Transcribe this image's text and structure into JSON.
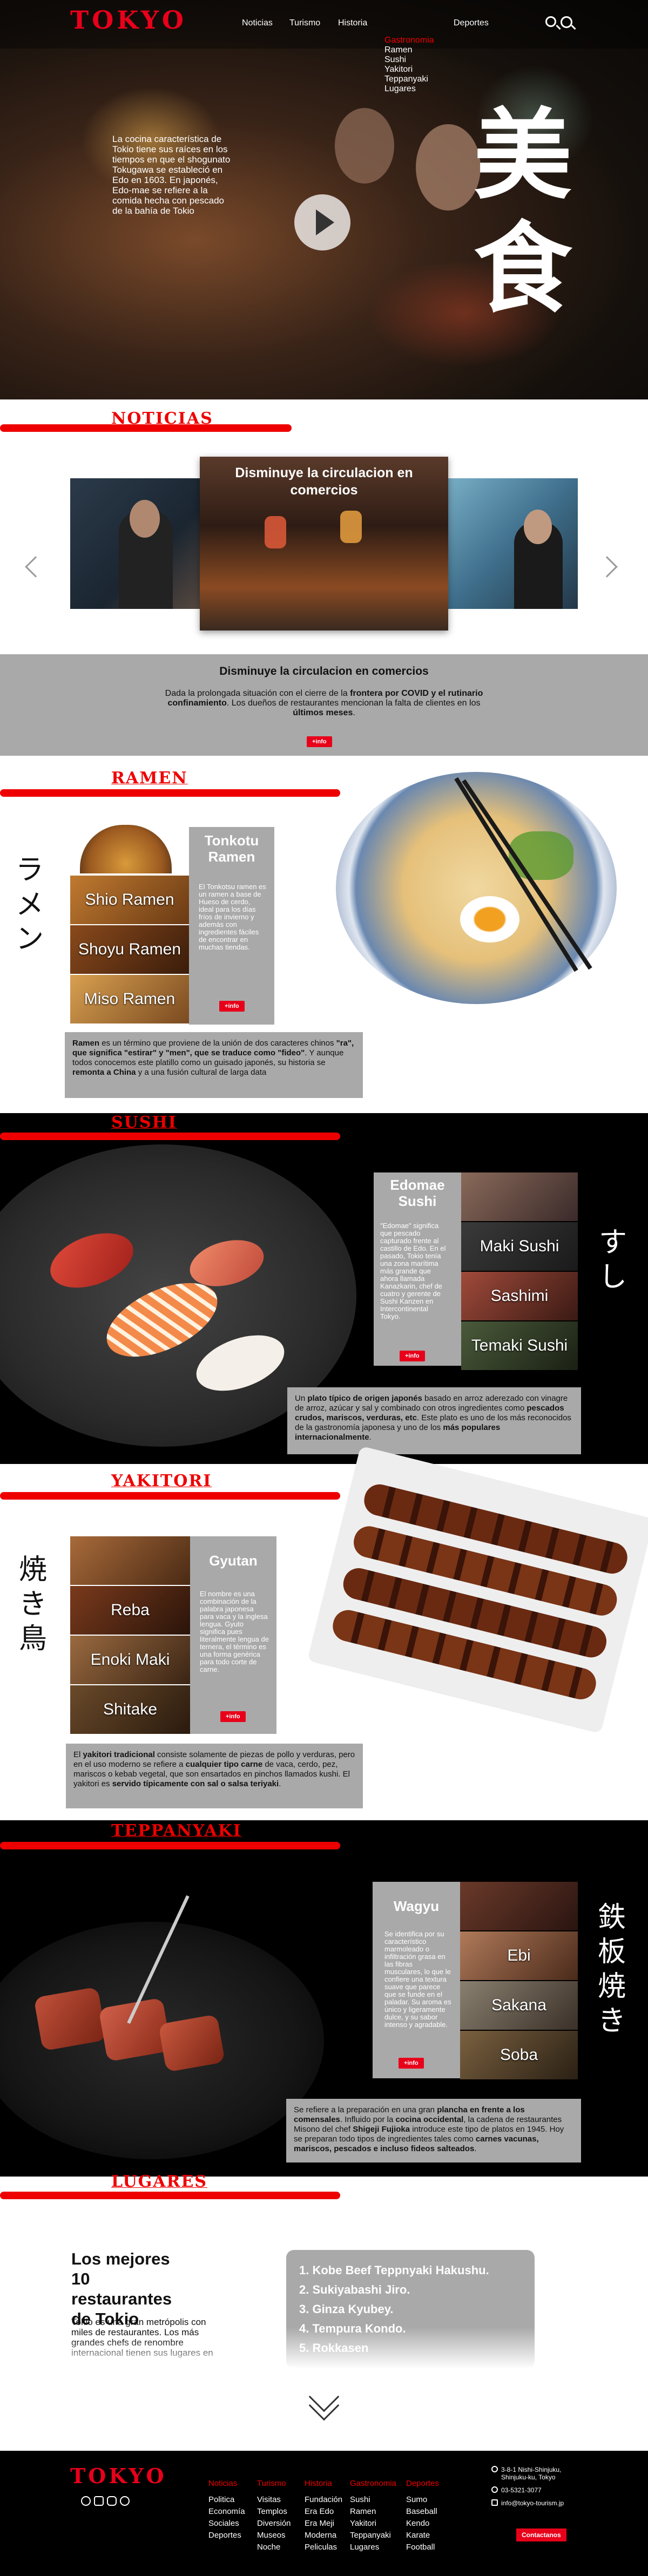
{
  "header": {
    "logo": "TOKYO",
    "nav": [
      "Noticias",
      "Turismo",
      "Historia",
      "Deportes"
    ],
    "gastro_menu": {
      "title": "Gastronomia",
      "items": [
        "Ramen",
        "Sushi",
        "Yakitori",
        "Teppanyaki",
        "Lugares"
      ]
    }
  },
  "hero": {
    "text": "La cocina característica de Tokio tiene sus raíces en los tiempos en que el shogunato Tokugawa se estableció en Edo en 1603. En japonés, Edo-mae se refiere a la comida hecha con pescado de la bahía de Tokio",
    "kanji": [
      "美",
      "食"
    ]
  },
  "news": {
    "title": "NOTICIAS",
    "card_title": "Disminuye la circulacion en comercios",
    "box_title": "Disminuye la circulacion en comercios",
    "box_text_a": "Dada la prolongada situación con el cierre de la ",
    "box_b1": "frontera por COVID y el rutinario confinamiento",
    "box_text_b": ". Los dueños de restaurantes mencionan la falta de clientes en los ",
    "box_b2": "últimos meses",
    "box_text_c": ".",
    "btn": "+info"
  },
  "ramen": {
    "title": "RAMEN",
    "kanji": [
      "ラ",
      "メ",
      "ン"
    ],
    "tiles": [
      "Shio Ramen",
      "Shoyu Ramen",
      "Miso Ramen"
    ],
    "side_title": "Tonkotu Ramen",
    "side_text": "El Tonkotsu ramen es un ramen a base de Hueso de cerdo, ideal para los días fríos de invierno y además con ingredientes fáciles de encontrar en muchas tiendas.",
    "btn": "+info",
    "desc": [
      {
        "b": "Ramen"
      },
      {
        "t": " es un término que proviene de la unión de dos caracteres chinos "
      },
      {
        "b": "\"ra\", que significa \"estirar\" y \"men\", que se traduce como \"fideo\""
      },
      {
        "t": ". Y aunque todos conocemos este platillo como un guisado japonés, su historia se "
      },
      {
        "b": "remonta a China"
      },
      {
        "t": " y a una fusión cultural de larga data"
      }
    ]
  },
  "sushi": {
    "title": "SUSHI",
    "kanji": [
      "す",
      "し"
    ],
    "side_title": "Edomae Sushi",
    "side_text": "\"Edomae\" significa que pescado capturado frente al castillo de Edo. En el pasado, Tokio tenía una zona marítima más grande que ahora llamada Kanazkarin, chef de cuatro y gerente de Sushi Kanzen en Intercontinental Tokyo.",
    "tiles": [
      "Maki Sushi",
      "Sashimi",
      "Temaki Sushi"
    ],
    "btn": "+info",
    "desc": [
      {
        "t": "Un "
      },
      {
        "b": "plato típico de origen japonés"
      },
      {
        "t": " basado en arroz aderezado con vinagre de arroz, azúcar y sal y combinado con otros ingredientes como "
      },
      {
        "b": "pescados crudos, mariscos, verduras, etc"
      },
      {
        "t": ". Este plato es uno de los más reconocidos de la gastronomía japonesa y uno de los "
      },
      {
        "b": "más populares internacionalmente"
      },
      {
        "t": "."
      }
    ]
  },
  "yakitori": {
    "title": "YAKITORI",
    "kanji": [
      "焼",
      "き",
      "鳥"
    ],
    "tiles": [
      "Reba",
      "Enoki Maki",
      "Shitake"
    ],
    "side_title": "Gyutan",
    "side_text": "El nombre es una combinación de la palabra japonesa para vaca y la inglesa lengua. Gyuto significa pues literalmente lengua de ternera, el término es una forma genérica para todo corte de carne.",
    "btn": "+info",
    "desc": [
      {
        "t": "El "
      },
      {
        "b": "yakitori tradicional"
      },
      {
        "t": " consiste solamente de piezas de pollo y verduras, pero en el uso moderno se refiere a "
      },
      {
        "b": "cualquier tipo carne"
      },
      {
        "t": " de vaca, cerdo, pez, mariscos o kebab vegetal, que son ensartados en pinchos llamados kushi. El yakitori es "
      },
      {
        "b": "servido típicamente con sal o salsa teriyaki"
      },
      {
        "t": "."
      }
    ]
  },
  "teppanyaki": {
    "title": "TEPPANYAKI",
    "kanji": [
      "鉄",
      "板",
      "焼",
      "き"
    ],
    "side_title": "Wagyu",
    "side_text": "Se identifica por su característico marmoleado o infiltración grasa en las fibras musculares, lo que le confiere una textura suave que parece que se funde en el paladar. Su aroma es único y ligeramente dulce, y su sabor intenso y agradable.",
    "tiles": [
      "Ebi",
      "Sakana",
      "Soba"
    ],
    "btn": "+info",
    "desc": [
      {
        "t": "Se refiere a la preparación en una gran "
      },
      {
        "b": "plancha en frente a los comensales"
      },
      {
        "t": ". Influido por la "
      },
      {
        "b": "cocina occidental"
      },
      {
        "t": ", la cadena de restaurantes Misono del chef "
      },
      {
        "b": "Shigeji Fujioka"
      },
      {
        "t": " introduce este tipo de platos en 1945. Hoy se preparan todo tipos de ingredientes tales como "
      },
      {
        "b": "carnes vacunas, mariscos, pescados e incluso fideos salteados"
      },
      {
        "t": "."
      }
    ]
  },
  "lugares": {
    "title": "LUGARES",
    "heading": "Los mejores 10 restaurantes de Tokio",
    "text": "Tokio es una gran metrópolis con miles de restaurantes. Los más grandes chefs de renombre internacional tienen sus lugares en",
    "list": [
      "1. Kobe Beef Teppnyaki Hakushu.",
      "2. Sukiyabashi Jiro.",
      "3. Ginza Kyubey.",
      "4. Tempura Kondo.",
      "5. Rokkasen"
    ]
  },
  "footer": {
    "logo": "TOKYO",
    "cols": [
      {
        "h": "Noticias",
        "items": [
          "Politica",
          "Economía",
          "Sociales",
          "Deportes"
        ]
      },
      {
        "h": "Turismo",
        "items": [
          "Visitas",
          "Templos",
          "Diversión",
          "Museos",
          "Noche"
        ]
      },
      {
        "h": "Historia",
        "items": [
          "Fundación",
          "Era Edo",
          "Era Meji",
          "Moderna",
          "Peliculas"
        ]
      },
      {
        "h": "Gastronomia",
        "items": [
          "Sushi",
          "Ramen",
          "Yakitori",
          "Teppanyaki",
          "Lugares"
        ]
      },
      {
        "h": "Deportes",
        "items": [
          "Sumo",
          "Baseball",
          "Kendo",
          "Karate",
          "Football"
        ]
      }
    ],
    "address": "3-8-1 Nishi-Shinjuku, Shinjuku-ku, Tokyo",
    "phone": "03-5321-3077",
    "email": "info@tokyo-tourism.jp",
    "contact_btn": "Contactanos"
  },
  "colors": {
    "accent": "#e8001a",
    "panel": "#a9a9a9",
    "dark": "#000000"
  }
}
